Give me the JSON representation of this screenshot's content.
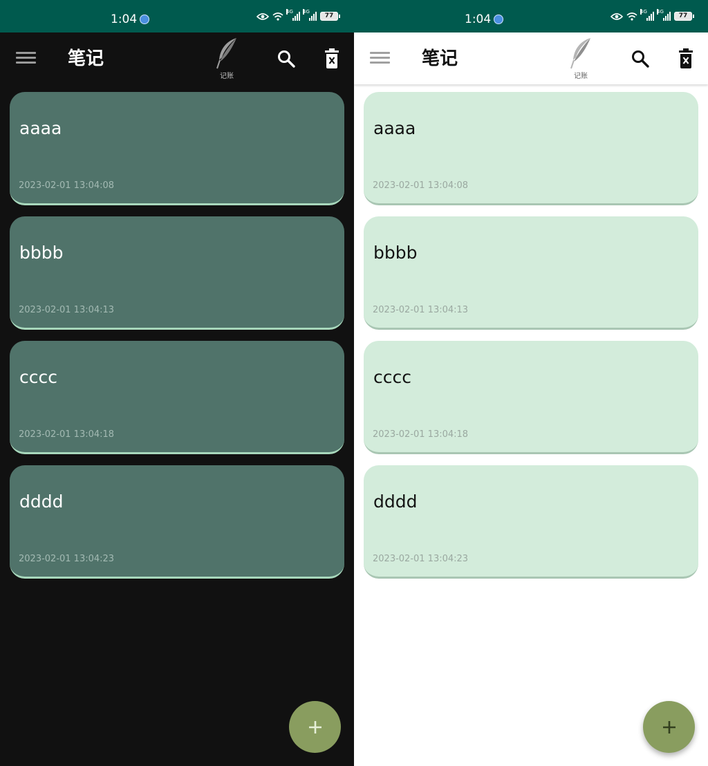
{
  "status_bar": {
    "time": "1:04",
    "battery": "77",
    "network_label": "4G"
  },
  "app_bar": {
    "title": "笔记",
    "logo_label": "记账"
  },
  "icons": {
    "menu": "menu-icon",
    "logo": "feather-icon",
    "search": "search-icon",
    "delete": "delete-icon",
    "add": "plus-icon"
  },
  "notes": [
    {
      "title": "aaaa",
      "date": "2023-02-01 13:04:08"
    },
    {
      "title": "bbbb",
      "date": "2023-02-01 13:04:13"
    },
    {
      "title": "cccc",
      "date": "2023-02-01 13:04:18"
    },
    {
      "title": "dddd",
      "date": "2023-02-01 13:04:23"
    }
  ],
  "colors": {
    "status_bar": "#005a4e",
    "dark_background": "#111111",
    "dark_card": "#50736a",
    "light_card": "#d3ecdb",
    "fab": "#899d5f"
  }
}
